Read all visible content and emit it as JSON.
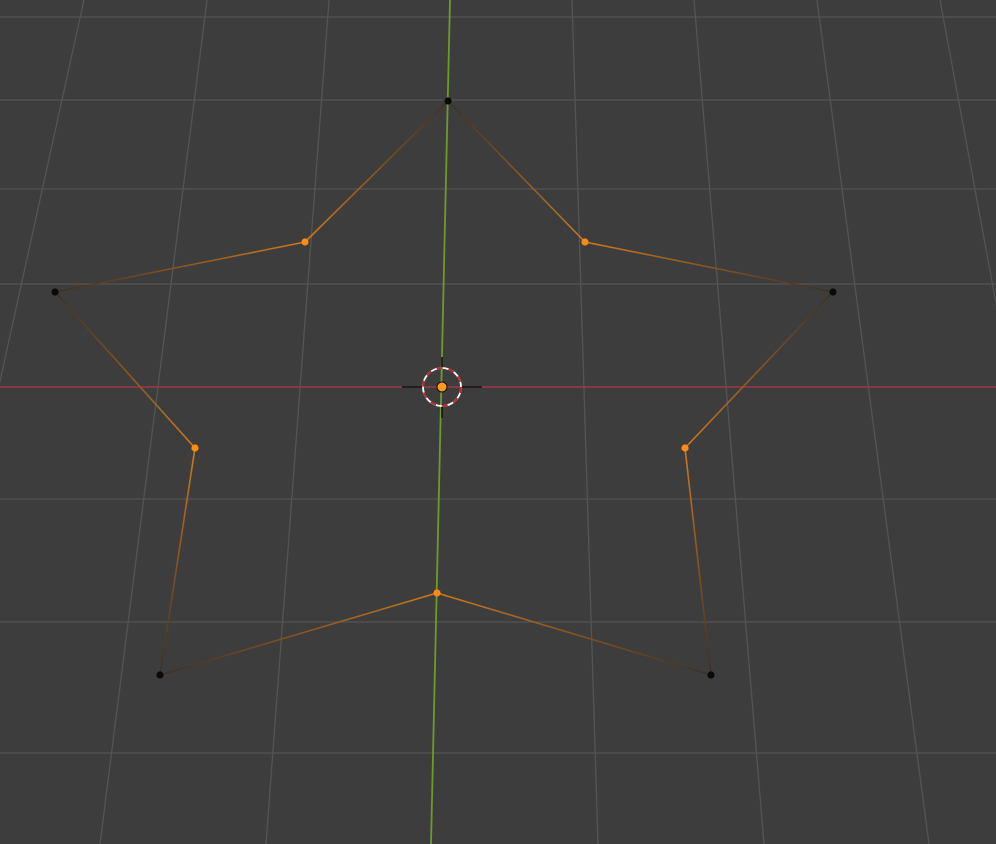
{
  "viewport": {
    "background_color": "#3d3d3d",
    "grid_color": "#545454",
    "x_axis_color": "#9a3a4a",
    "y_axis_color": "#6e9a2a"
  },
  "mesh": {
    "shape": "star",
    "point_count": 5,
    "edge_selected_color": "#d07a1c",
    "edge_unselected_color": "#2e2a26",
    "selected_vertex_color": "#ff8a14",
    "unselected_vertex_color": "#0a0a0a",
    "vertices": [
      {
        "id": "outer-top",
        "selected": false
      },
      {
        "id": "inner-top-right",
        "selected": true
      },
      {
        "id": "outer-right",
        "selected": false
      },
      {
        "id": "inner-bottom-right",
        "selected": true
      },
      {
        "id": "outer-bottom-right",
        "selected": false
      },
      {
        "id": "inner-bottom",
        "selected": true
      },
      {
        "id": "outer-bottom-left",
        "selected": false
      },
      {
        "id": "inner-bottom-left",
        "selected": true
      },
      {
        "id": "outer-left",
        "selected": false
      },
      {
        "id": "inner-top-left",
        "selected": true
      }
    ]
  },
  "cursor_3d": {
    "icon": "3d-cursor-icon",
    "ring_color_a": "#ffffff",
    "ring_color_b": "#cc2222"
  },
  "origin": {
    "icon": "object-origin-icon",
    "color": "#ff9a1e"
  }
}
